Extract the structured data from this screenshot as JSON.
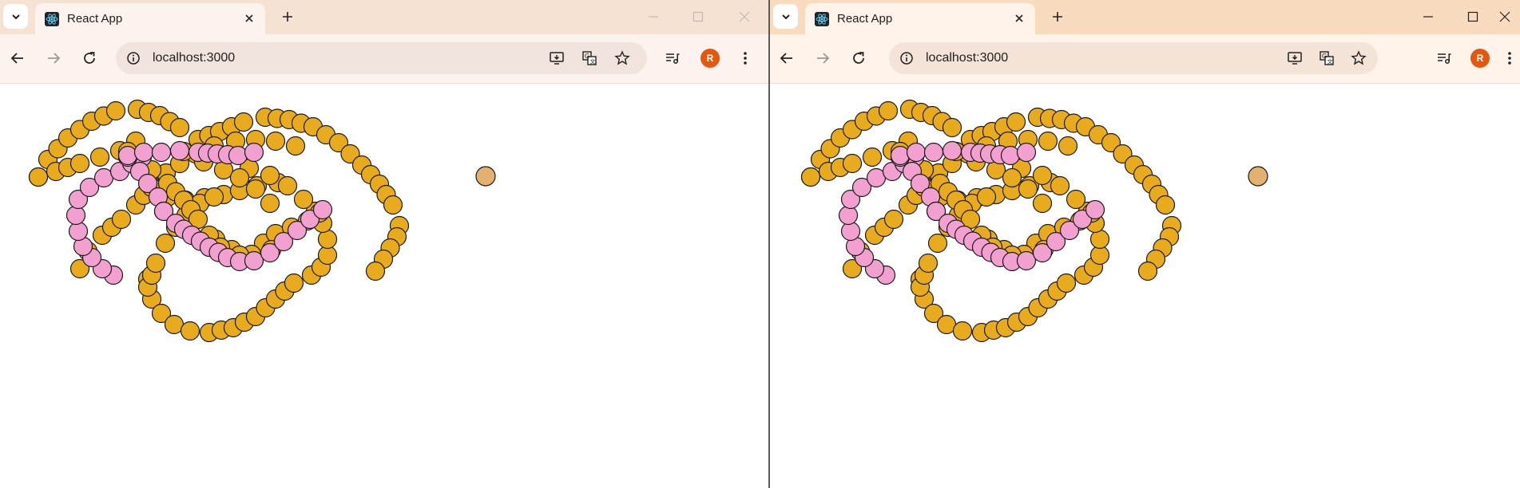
{
  "windows": [
    {
      "tab": {
        "title": "React App"
      },
      "address": {
        "url": "localhost:3000"
      },
      "profile": {
        "initial": "R"
      }
    },
    {
      "tab": {
        "title": "React App"
      },
      "address": {
        "url": "localhost:3000"
      },
      "profile": {
        "initial": "R"
      }
    }
  ],
  "colors": {
    "ball_yellow": "#e8ab1e",
    "ball_pink": "#f1a0cf",
    "target_ball": "#e3b170",
    "outline": "#1a1a1a",
    "profile_avatar": "#e5570f"
  },
  "icons": [
    "tab-search-icon",
    "react-favicon-icon",
    "close-icon",
    "plus-icon",
    "minimize-icon",
    "maximize-icon",
    "back-arrow-icon",
    "forward-arrow-icon",
    "reload-icon",
    "site-info-icon",
    "install-app-icon",
    "translate-icon",
    "bookmark-star-icon",
    "media-controls-icon",
    "more-vertical-icon"
  ]
}
